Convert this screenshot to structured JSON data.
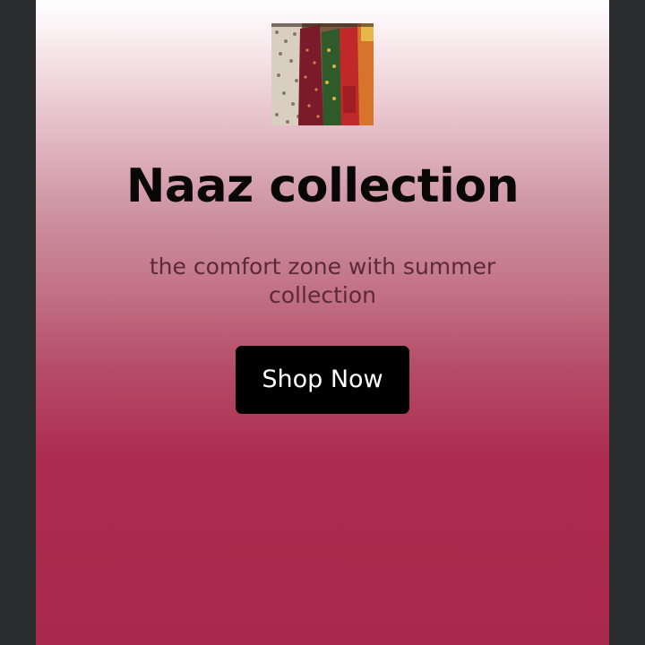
{
  "hero": {
    "image_alt": "Naaz collection dresses",
    "title": "Naaz collection",
    "subtitle": "the comfort zone with summer collection",
    "cta_label": "Shop Now"
  },
  "colors": {
    "background_outer": "#2b2c2e",
    "gradient_top": "#ffffff",
    "gradient_bottom": "#a9294c",
    "title_text": "#0a0708",
    "subtitle_text": "#5b2a3a",
    "button_bg": "#000000",
    "button_text": "#ffffff"
  }
}
